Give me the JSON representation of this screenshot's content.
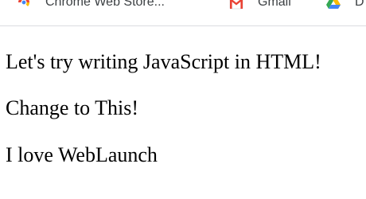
{
  "bookmarks_bar": {
    "items": [
      {
        "label": "Chrome Web Store...",
        "icon": "chrome-web-store-icon"
      },
      {
        "label": "Gmail",
        "icon": "gmail-icon"
      },
      {
        "label": "D",
        "icon": "google-drive-icon"
      }
    ]
  },
  "page": {
    "paragraphs": [
      "Let's try writing JavaScript in HTML!",
      "Change to This!",
      "I love WebLaunch"
    ]
  },
  "colors": {
    "gmail_red": "#ea4335",
    "drive_green": "#34a853",
    "drive_yellow": "#fbbc04",
    "drive_blue": "#4285f4",
    "chrome_red": "#ea4335",
    "chrome_yellow": "#fbbc04"
  }
}
